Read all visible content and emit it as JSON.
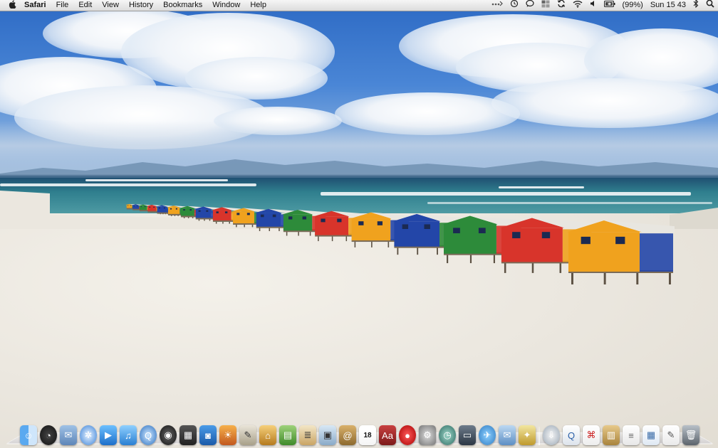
{
  "menubar": {
    "apple_menu": "",
    "app_name": "Safari",
    "menus": [
      "File",
      "Edit",
      "View",
      "History",
      "Bookmarks",
      "Window",
      "Help"
    ],
    "battery": "(99%)",
    "clock": "Sun 15 43"
  },
  "icons": {
    "apple": "apple-icon",
    "status": [
      "activity-icon",
      "time-machine-icon",
      "chat-icon",
      "spaces-icon",
      "sync-icon",
      "wifi-icon",
      "volume-icon",
      "battery-icon",
      "bluetooth-icon",
      "spotlight-icon"
    ]
  },
  "dock": {
    "calendar_day": "18",
    "apps": [
      "finder",
      "dashboard",
      "mail",
      "safari",
      "facetime",
      "itunes",
      "quicktime",
      "dvd-player",
      "final-cut",
      "photo-booth",
      "iphoto",
      "script-editor",
      "keynote",
      "numbers",
      "pages",
      "preview",
      "address-book",
      "ical",
      "dictionary",
      "recorder",
      "system-preferences",
      "time-machine",
      "screen-sharing",
      "maps",
      "mail-stationery",
      "app-store"
    ],
    "docs": [
      "downloads",
      "quick-look-doc",
      "pdf-doc",
      "archive",
      "document",
      "spreadsheet",
      "textedit-doc",
      "trash"
    ]
  },
  "colors": {
    "menubar_top": "#f6f6f6",
    "menubar_bottom": "#dcdcdc",
    "sky": "#2d6ac4",
    "sea": "#2f7f8e",
    "sand": "#ebe7df"
  }
}
